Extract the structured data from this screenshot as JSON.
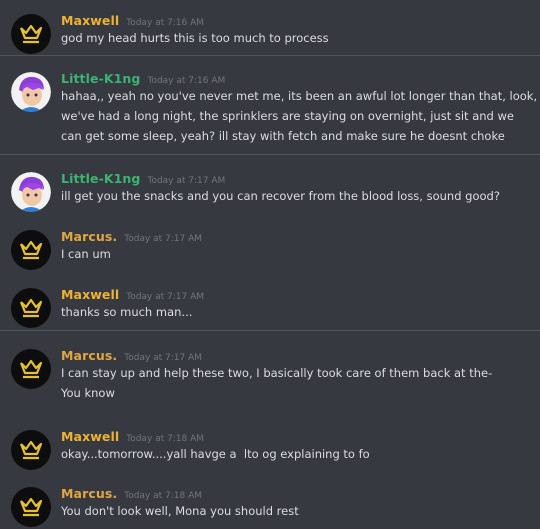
{
  "colors": {
    "background": "#36393f",
    "maxwell": "#f0b232",
    "marcus": "#e3a640",
    "little_king": "#3cb371",
    "timestamp": "#72767d",
    "text": "#dcddde"
  },
  "messages": [
    {
      "author": "Maxwell",
      "timestamp": "Today at 7:16 AM",
      "avatar_icon": "crown-icon",
      "lines": [
        "god my head hurts this is too much to process"
      ]
    },
    {
      "author": "Little-K1ng",
      "timestamp": "Today at 7:16 AM",
      "avatar_icon": "purple-hair-avatar-icon",
      "lines": [
        "hahaa,, yeah no you've never met me, its been an awful lot longer than that, look,",
        "we've had a long night, the sprinklers are staying on overnight, just sit and we",
        "can get some sleep, yeah? ill stay with fetch and make sure he doesnt choke"
      ]
    },
    {
      "author": "Little-K1ng",
      "timestamp": "Today at 7:17 AM",
      "avatar_icon": "purple-hair-avatar-icon",
      "lines": [
        "ill get you the snacks and you can recover from the blood loss, sound good?"
      ]
    },
    {
      "author": "Marcus.",
      "timestamp": "Today at 7:17 AM",
      "avatar_icon": "crown-icon",
      "lines": [
        "I can um"
      ]
    },
    {
      "author": "Maxwell",
      "timestamp": "Today at 7:17 AM",
      "avatar_icon": "crown-icon",
      "lines": [
        "thanks so much man..."
      ]
    },
    {
      "author": "Marcus.",
      "timestamp": "Today at 7:17 AM",
      "avatar_icon": "crown-icon",
      "lines": [
        "I can stay up and help these two, I basically took care of them back at the-",
        "You know"
      ]
    },
    {
      "author": "Maxwell",
      "timestamp": "Today at 7:18 AM",
      "avatar_icon": "crown-icon",
      "lines": [
        "okay...tomorrow....yall havge a  lto og explaining to fo"
      ]
    },
    {
      "author": "Marcus.",
      "timestamp": "Today at 7:18 AM",
      "avatar_icon": "crown-icon",
      "lines": [
        "You don't look well, Mona you should rest"
      ]
    }
  ]
}
